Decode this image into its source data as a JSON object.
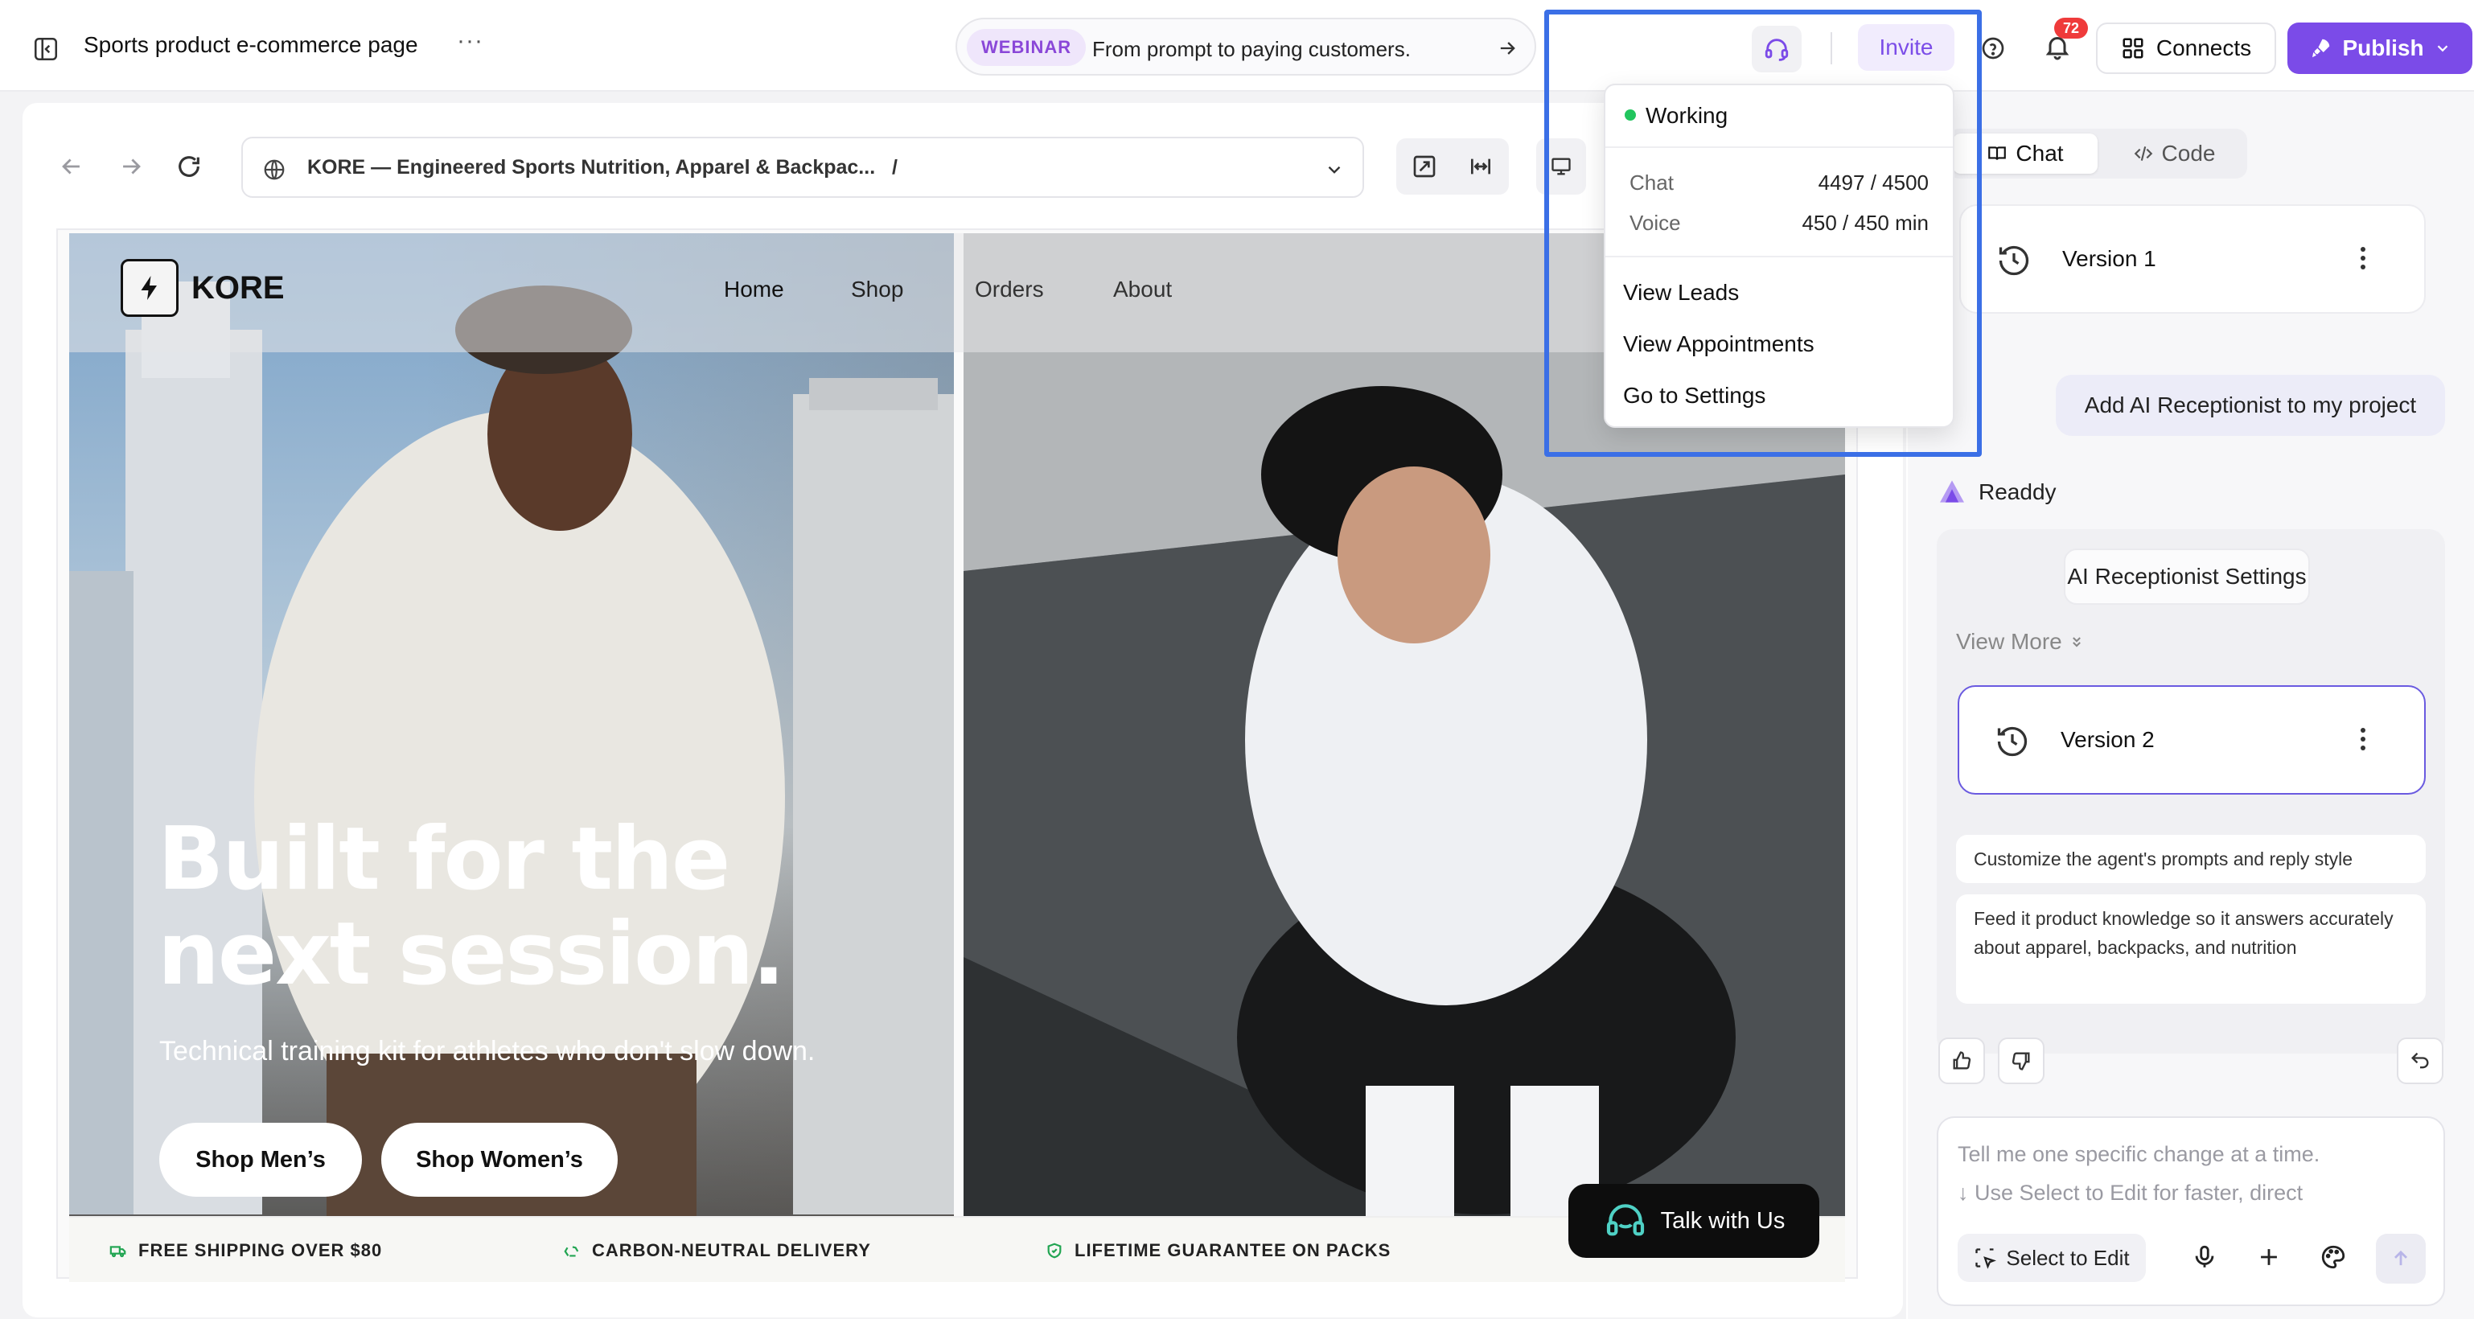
{
  "header": {
    "page_title": "Sports product e-commerce page",
    "more_icon": "more-horizontal-icon",
    "webinar_badge": "WEBINAR",
    "webinar_text": "From prompt to paying customers.",
    "invite_label": "Invite",
    "notification_count": "72",
    "connects_label": "Connects",
    "publish_label": "Publish"
  },
  "status_menu": {
    "status": "Working",
    "status_color": "#22c55e",
    "chat_label": "Chat",
    "chat_value": "4497 / 4500",
    "voice_label": "Voice",
    "voice_value": "450 / 450 min",
    "items": [
      "View Leads",
      "View Appointments",
      "Go to Settings"
    ]
  },
  "browser": {
    "url_title": "KORE — Engineered Sports Nutrition, Apparel & Backpac...",
    "url_path": "/"
  },
  "site": {
    "brand": "KORE",
    "nav": [
      "Home",
      "Shop",
      "Orders",
      "About"
    ],
    "hero_title": "Built for the next session.",
    "hero_subtitle": "Technical training kit for athletes who don't slow down.",
    "cta_men": "Shop Men’s",
    "cta_women": "Shop Women’s",
    "features": [
      "FREE SHIPPING OVER $80",
      "CARBON-NEUTRAL DELIVERY",
      "LIFETIME GUARANTEE ON PACKS"
    ],
    "talk_label": "Talk with Us"
  },
  "panel": {
    "tabs": [
      "Chat",
      "Code"
    ],
    "version1": "Version 1",
    "version2": "Version 2",
    "user_message": "Add AI Receptionist to my project",
    "assistant_name": "Readdy",
    "settings_chip": "AI Receptionist Settings",
    "view_more": "View More",
    "suggestions": [
      "Customize the agent's prompts and reply style",
      "Feed it product knowledge so it answers accurately about apparel, backpacks, and nutrition"
    ],
    "composer_placeholder_1": "Tell me one specific change at a time.",
    "composer_placeholder_2": "↓ Use Select to Edit for faster, direct",
    "select_to_edit": "Select to Edit"
  },
  "colors": {
    "accent": "#7b4be8",
    "highlight": "#3b6fe6",
    "badge": "#ef3b3b"
  }
}
